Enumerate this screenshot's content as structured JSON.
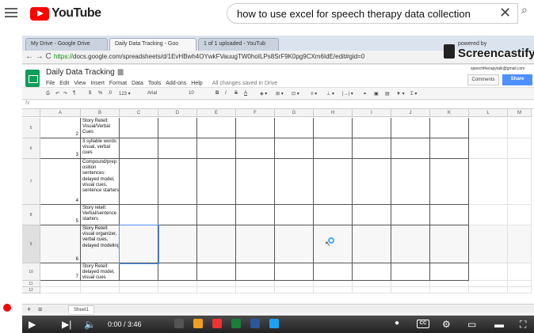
{
  "youtube": {
    "logo_text": "YouTube",
    "search_value": "how to use excel for speech therapy data collection"
  },
  "browser": {
    "tabs": [
      {
        "label": "My Drive - Google Drive"
      },
      {
        "label": "Daily Data Tracking - Goo"
      },
      {
        "label": "1 of 1 uploaded - YouTub"
      }
    ],
    "url_secure": "https://",
    "url_rest": "docs.google.com/spreadsheets/d/1EvHBwh4OYwkFVauugTW0hoILPs8SrF9K0pg9CXm6IdE/edit#gid=0"
  },
  "screencastify": {
    "powered_by": "powered by",
    "name": "Screencastify Lit"
  },
  "sheets": {
    "title": "Daily Data Tracking",
    "menus": [
      "File",
      "Edit",
      "View",
      "Insert",
      "Format",
      "Data",
      "Tools",
      "Add-ons",
      "Help"
    ],
    "saved_status": "All changes saved in Drive",
    "account": "speechtherapytalk@gmail.com",
    "comments_label": "Comments",
    "share_label": "Share",
    "font_name": "Arial",
    "font_size": "10",
    "fx": "fx",
    "columns": [
      "A",
      "B",
      "C",
      "D",
      "E",
      "F",
      "G",
      "H",
      "I",
      "J",
      "K",
      "L",
      "M"
    ],
    "rows": [
      {
        "num": "5",
        "a": "2",
        "b": "Story Retell: Visual/Verbal Cues"
      },
      {
        "num": "6",
        "a": "3",
        "b": "3 syllable words: visual, verbal cues"
      },
      {
        "num": "7",
        "a": "4",
        "b": "Compound/prep osition sentences: delayed model, visual cues, sentence starters"
      },
      {
        "num": "8",
        "a": "5",
        "b": "Story retell: Verbal/sentence starters"
      },
      {
        "num": "9",
        "a": "6",
        "b": "Story Retell: visual organizer, verbal cues, delayed modeling"
      },
      {
        "num": "10",
        "a": "7",
        "b": "Story Retell: delayed model, visual cues"
      },
      {
        "num": "11",
        "a": "",
        "b": ""
      },
      {
        "num": "12",
        "a": "",
        "b": ""
      }
    ],
    "sheet_tab": "Sheet1"
  },
  "player": {
    "time": "0:00 / 3:46",
    "progress_fraction": 0.0
  }
}
